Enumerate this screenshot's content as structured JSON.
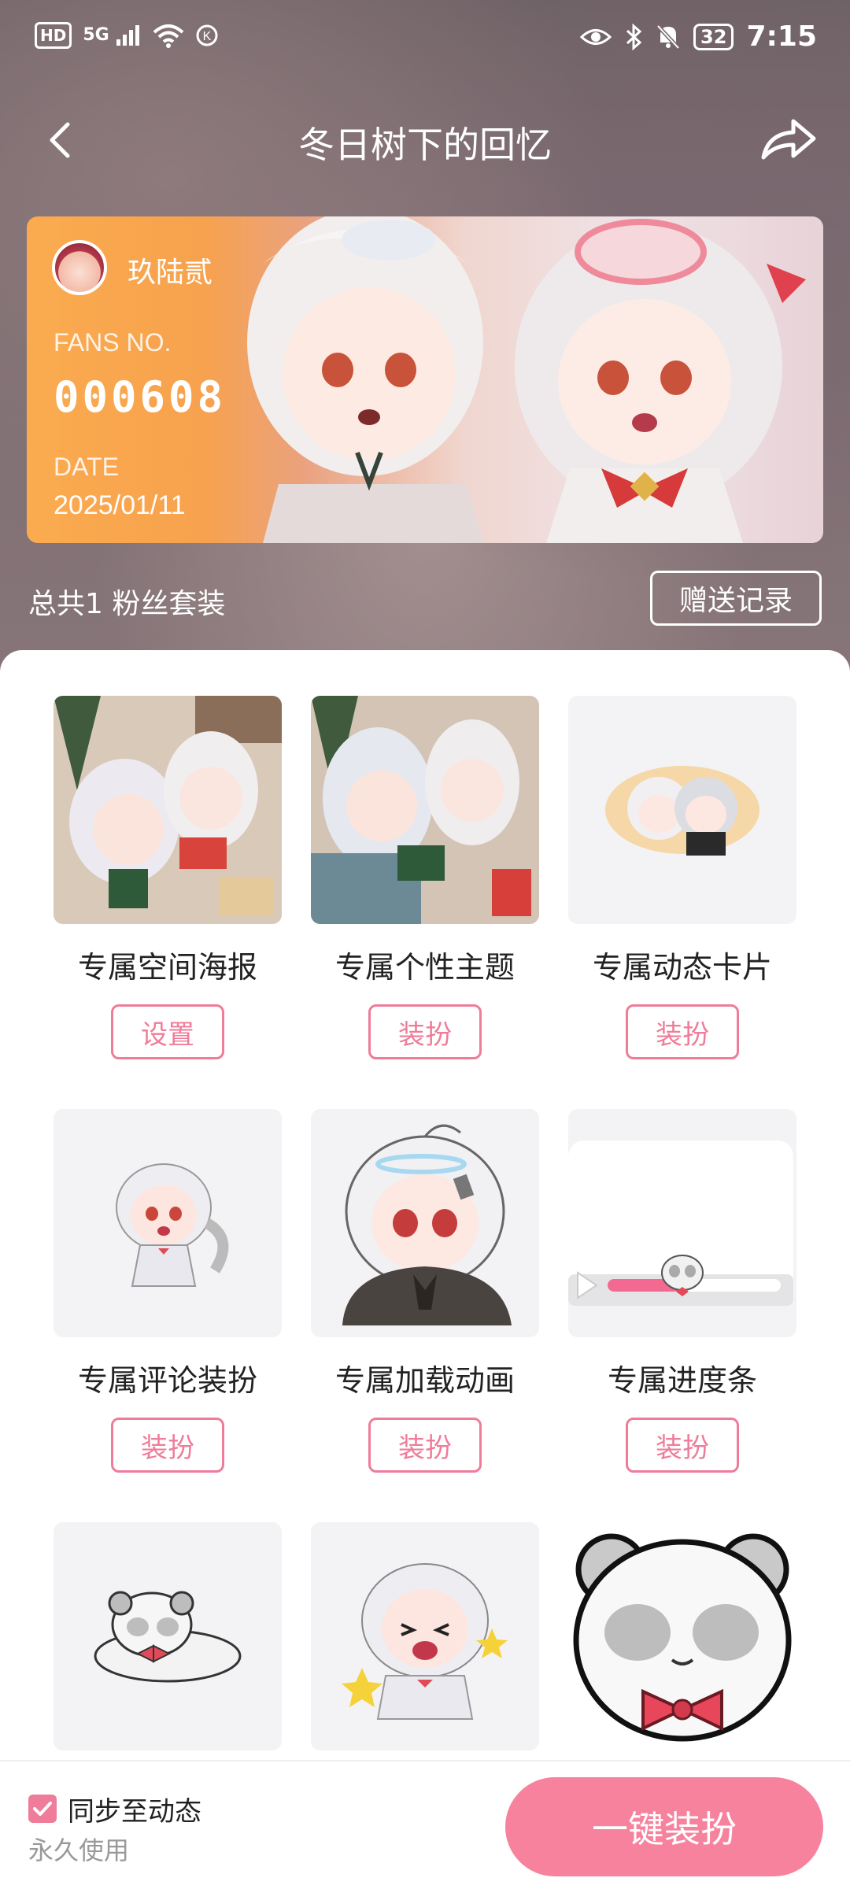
{
  "status_bar": {
    "network": "HD",
    "signal": "5G",
    "time": "7:15",
    "battery": "32"
  },
  "nav": {
    "title": "冬日树下的回忆",
    "back_icon": "chevron-left-icon",
    "share_icon": "share-arrow-icon"
  },
  "card": {
    "name": "玖陆贰",
    "fans_label": "FANS NO.",
    "fans_no": "000608",
    "date_label": "DATE",
    "date": "2025/01/11"
  },
  "summary": {
    "total": "总共1 粉丝套装",
    "gift_record": "赠送记录"
  },
  "items": [
    {
      "label": "专属空间海报",
      "button": "设置"
    },
    {
      "label": "专属个性主题",
      "button": "装扮"
    },
    {
      "label": "专属动态卡片",
      "button": "装扮"
    },
    {
      "label": "专属评论装扮",
      "button": "装扮"
    },
    {
      "label": "专属加载动画",
      "button": "装扮"
    },
    {
      "label": "专属进度条",
      "button": "装扮"
    },
    {
      "label": "",
      "button": ""
    },
    {
      "label": "",
      "button": ""
    },
    {
      "label": "",
      "button": ""
    }
  ],
  "bottom": {
    "sync_label": "同步至动态",
    "sync_checked": true,
    "permanent": "永久使用",
    "one_key": "一键装扮"
  },
  "colors": {
    "accent": "#ef7c9a",
    "card_orange": "#fbab4f"
  }
}
